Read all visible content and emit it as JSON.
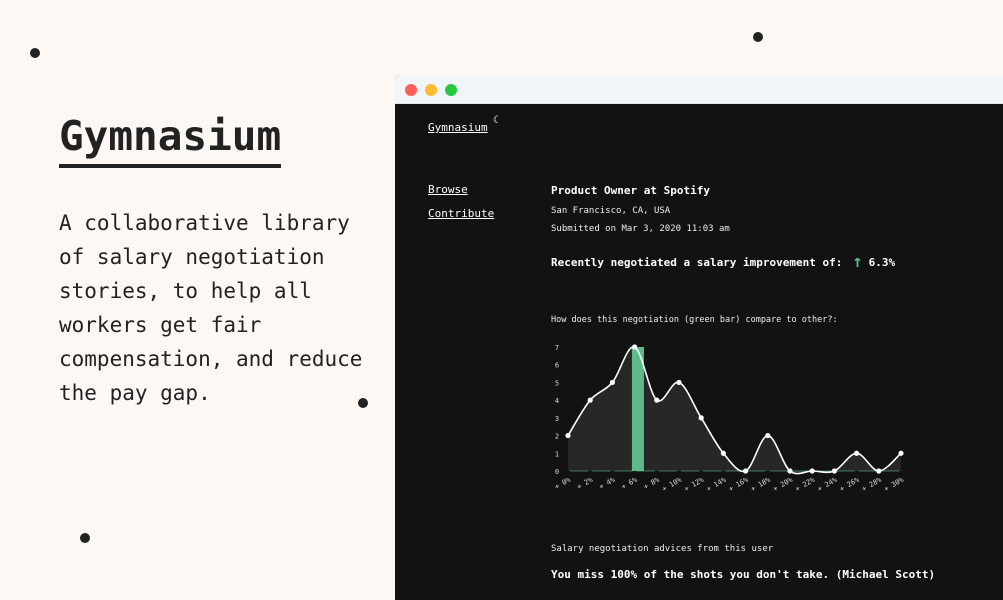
{
  "hero": {
    "title": "Gymnasium",
    "description": "A collaborative library of salary negotiation stories, to help all workers get fair compensation, and reduce the pay gap."
  },
  "window": {
    "traffic_colors": [
      "#ff5f57",
      "#febc2e",
      "#28c840"
    ]
  },
  "app": {
    "logo": "Gymnasium",
    "moon_icon": "crescent-moon-icon",
    "nav": [
      {
        "label": "Browse"
      },
      {
        "label": "Contribute"
      }
    ]
  },
  "story": {
    "title": "Product Owner at Spotify",
    "location": "San Francisco, CA, USA",
    "submitted": "Submitted on Mar 3, 2020 11:03 am",
    "improvement_label": "Recently negotiated a salary improvement of:",
    "improvement_value": "6.3%",
    "chart_question": "How does this negotiation (green bar) compare to other?:",
    "advice_heading": "Salary negotiation advices from this user",
    "quote": "You miss 100% of the shots you don't take. (Michael Scott)"
  },
  "colors": {
    "accent": "#5dbb8a",
    "panel": "#121212"
  },
  "chart_data": {
    "type": "area",
    "categories": [
      "+ 0%",
      "+ 2%",
      "+ 4%",
      "+ 6%",
      "+ 8%",
      "+ 10%",
      "+ 12%",
      "+ 14%",
      "+ 16%",
      "+ 18%",
      "+ 20%",
      "+ 22%",
      "+ 24%",
      "+ 26%",
      "+ 28%",
      "+ 30%"
    ],
    "points_x": [
      0,
      1,
      2,
      3,
      4,
      5,
      6,
      7,
      8,
      9,
      10,
      11,
      12,
      13,
      14,
      15
    ],
    "values": [
      2,
      4,
      5,
      7,
      4,
      5,
      3,
      1,
      0,
      2,
      0,
      0,
      0,
      1,
      0,
      1
    ],
    "highlight_bar": {
      "x": 3.15,
      "value": 7
    },
    "yticks": [
      0,
      1,
      2,
      3,
      4,
      5,
      6,
      7
    ],
    "ylim": [
      0,
      7
    ],
    "grid": false
  }
}
